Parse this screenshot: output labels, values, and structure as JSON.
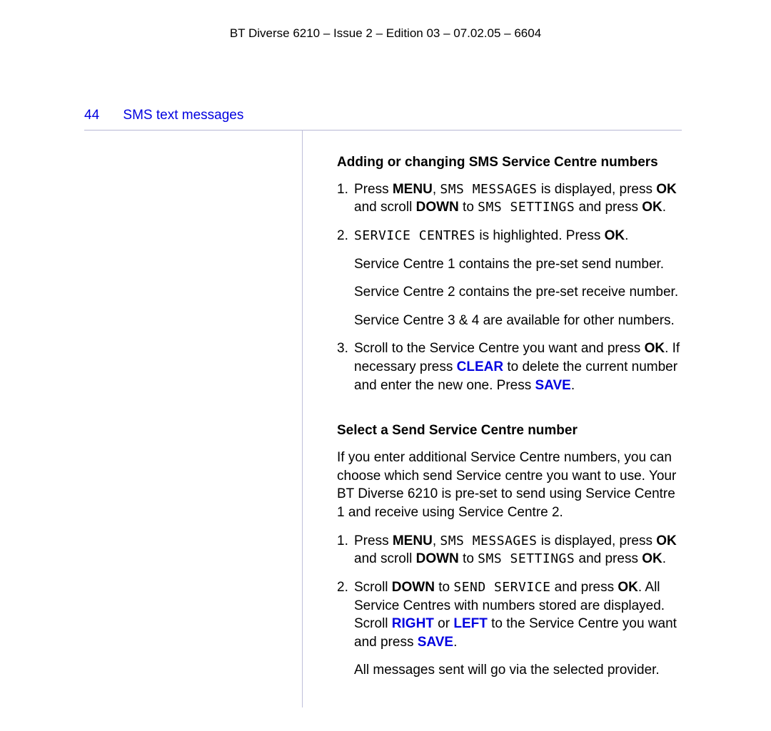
{
  "header": "BT Diverse 6210 – Issue 2 – Edition 03 – 07.02.05 – 6604",
  "page_number": "44",
  "section_title": "SMS text messages",
  "section_a": {
    "heading": "Adding or changing SMS Service Centre numbers",
    "steps": [
      {
        "n": "1.",
        "parts": [
          {
            "t": "Press "
          },
          {
            "t": "MENU",
            "cls": "b"
          },
          {
            "t": ", "
          },
          {
            "t": "SMS MESSAGES",
            "cls": "lcd"
          },
          {
            "t": " is displayed, press "
          },
          {
            "t": "OK",
            "cls": "b"
          },
          {
            "t": " and scroll "
          },
          {
            "t": "DOWN",
            "cls": "b"
          },
          {
            "t": " to "
          },
          {
            "t": "SMS SETTINGS",
            "cls": "lcd"
          },
          {
            "t": " and press "
          },
          {
            "t": "OK",
            "cls": "b"
          },
          {
            "t": "."
          }
        ]
      },
      {
        "n": "2.",
        "parts": [
          {
            "t": "SERVICE CENTRES",
            "cls": "lcd"
          },
          {
            "t": " is highlighted. Press "
          },
          {
            "t": "OK",
            "cls": "b"
          },
          {
            "t": "."
          }
        ],
        "subs": [
          "Service Centre 1 contains the pre-set send number.",
          "Service Centre 2 contains the pre-set receive number.",
          "Service Centre 3 & 4 are available for other numbers."
        ]
      },
      {
        "n": "3.",
        "parts": [
          {
            "t": "Scroll to the Service Centre you want and press "
          },
          {
            "t": "OK",
            "cls": "b"
          },
          {
            "t": ". If necessary press "
          },
          {
            "t": "CLEAR",
            "cls": "blue"
          },
          {
            "t": " to delete the current number and enter the new one. Press "
          },
          {
            "t": "SAVE",
            "cls": "blue"
          },
          {
            "t": "."
          }
        ]
      }
    ]
  },
  "section_b": {
    "heading": "Select a Send Service Centre number",
    "intro": "If you enter additional Service Centre numbers, you can choose which send Service centre you want to use. Your BT Diverse 6210 is pre-set to send using Service Centre 1 and receive using Service Centre 2.",
    "steps": [
      {
        "n": "1.",
        "parts": [
          {
            "t": "Press "
          },
          {
            "t": "MENU",
            "cls": "b"
          },
          {
            "t": ", "
          },
          {
            "t": "SMS MESSAGES",
            "cls": "lcd"
          },
          {
            "t": " is displayed, press "
          },
          {
            "t": "OK",
            "cls": "b"
          },
          {
            "t": " and scroll "
          },
          {
            "t": "DOWN",
            "cls": "b"
          },
          {
            "t": " to "
          },
          {
            "t": "SMS SETTINGS",
            "cls": "lcd"
          },
          {
            "t": " and press "
          },
          {
            "t": "OK",
            "cls": "b"
          },
          {
            "t": "."
          }
        ]
      },
      {
        "n": "2.",
        "parts": [
          {
            "t": "Scroll "
          },
          {
            "t": "DOWN",
            "cls": "b"
          },
          {
            "t": " to "
          },
          {
            "t": "SEND SERVICE",
            "cls": "lcd"
          },
          {
            "t": " and press "
          },
          {
            "t": "OK",
            "cls": "b"
          },
          {
            "t": ". All Service Centres with numbers stored are displayed. Scroll "
          },
          {
            "t": "RIGHT",
            "cls": "blue"
          },
          {
            "t": " or "
          },
          {
            "t": "LEFT",
            "cls": "blue"
          },
          {
            "t": " to the Service Centre you want and press "
          },
          {
            "t": "SAVE",
            "cls": "blue"
          },
          {
            "t": "."
          }
        ],
        "subs": [
          "All messages sent will go via the selected provider."
        ]
      }
    ]
  }
}
